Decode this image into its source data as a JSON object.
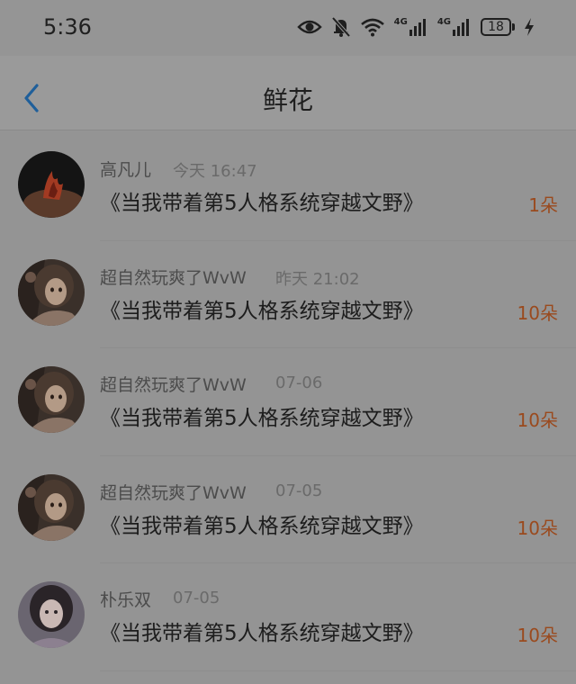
{
  "status_bar": {
    "time": "5:36",
    "network_1": "4G",
    "network_2": "4G",
    "battery": "18"
  },
  "header": {
    "title": "鲜花"
  },
  "items": [
    {
      "sender": "高凡儿",
      "date": "今天 16:47",
      "book": "《当我带着第5人格系统穿越文野》",
      "count": "1朵",
      "avatar": "flame-wrist"
    },
    {
      "sender": "超自然玩爽了WvW",
      "date": "昨天 21:02",
      "book": "《当我带着第5人格系统穿越文野》",
      "count": "10朵",
      "avatar": "anime-girl"
    },
    {
      "sender": "超自然玩爽了WvW",
      "date": "07-06",
      "book": "《当我带着第5人格系统穿越文野》",
      "count": "10朵",
      "avatar": "anime-girl"
    },
    {
      "sender": "超自然玩爽了WvW",
      "date": "07-05",
      "book": "《当我带着第5人格系统穿越文野》",
      "count": "10朵",
      "avatar": "anime-girl"
    },
    {
      "sender": "朴乐双",
      "date": "07-05",
      "book": "《当我带着第5人格系统穿越文野》",
      "count": "10朵",
      "avatar": "girl-portrait"
    }
  ],
  "colors": {
    "accent_count": "#9a4a1e",
    "back_arrow": "#1f5f9a"
  }
}
